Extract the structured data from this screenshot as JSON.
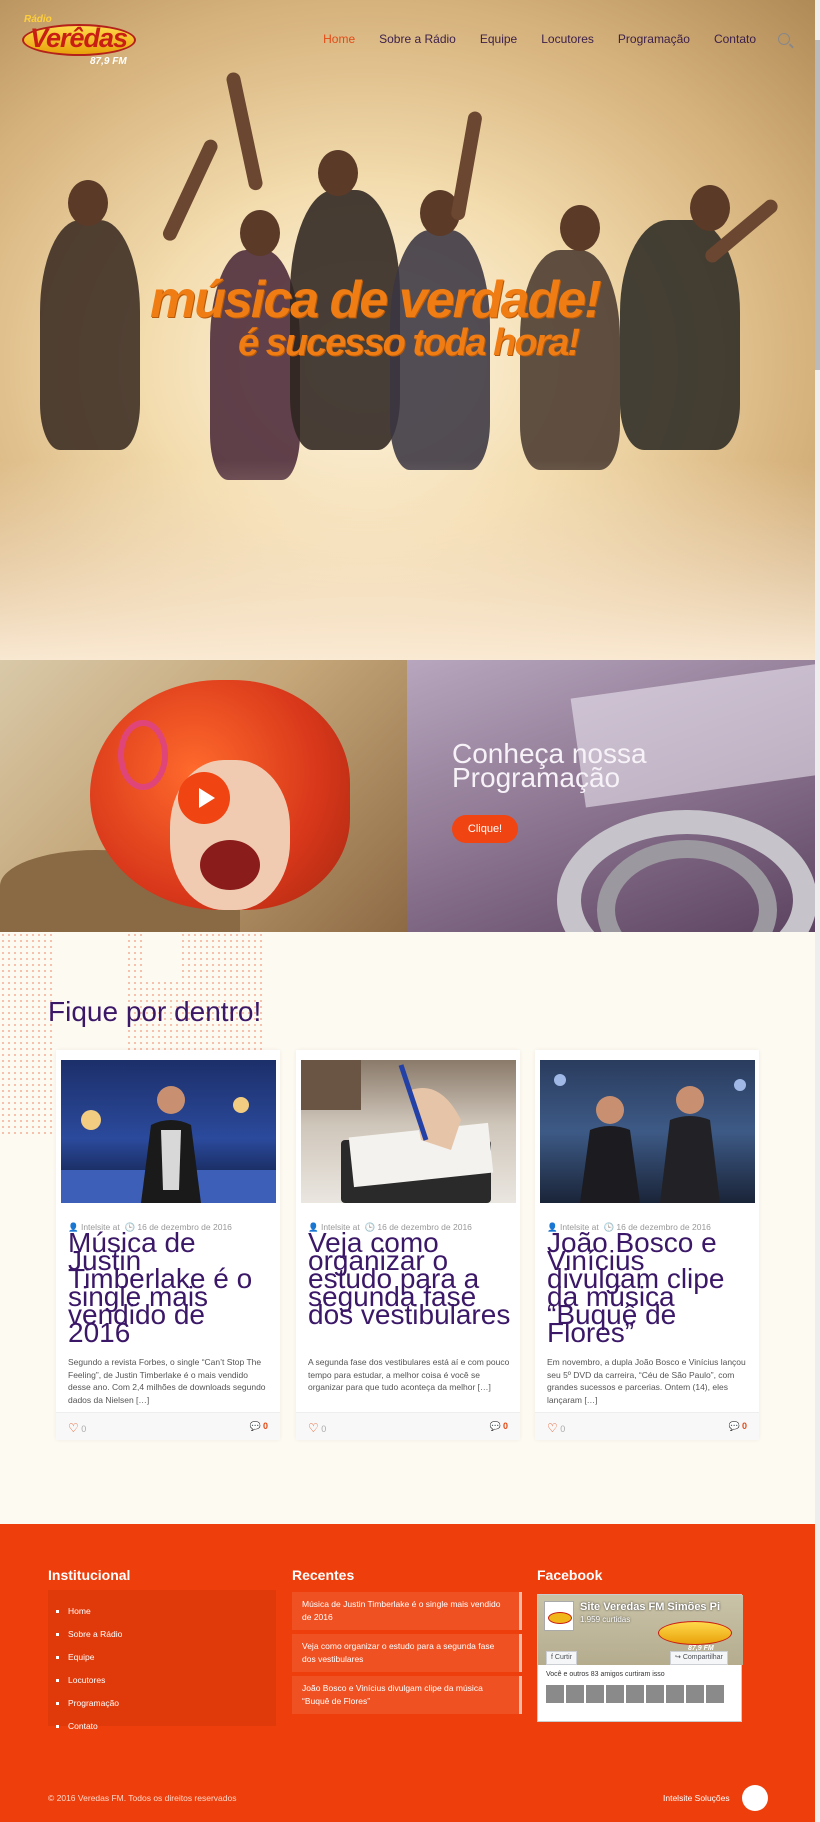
{
  "header": {
    "logo": {
      "top": "Rádio",
      "word": "Verêdas",
      "freq": "87,9 FM"
    },
    "nav": [
      {
        "label": "Home",
        "active": true
      },
      {
        "label": "Sobre a Rádio"
      },
      {
        "label": "Equipe"
      },
      {
        "label": "Locutores"
      },
      {
        "label": "Programação"
      },
      {
        "label": "Contato"
      }
    ],
    "search_icon": "search-icon"
  },
  "hero": {
    "line1": "música de verdade!",
    "line2": "é sucesso toda hora!"
  },
  "promo": {
    "heading": "Conheça nossa Programação",
    "button": "Clique!"
  },
  "news": {
    "title": "Fique por dentro!",
    "cards": [
      {
        "author": "Intelsite",
        "at": "at",
        "date": "16 de dezembro de 2016",
        "title": "Música de Justin Timberlake é o single mais vendido de 2016",
        "excerpt": "Segundo a revista Forbes, o single “Can’t Stop The Feeling”, de Justin Timberlake é o mais vendido desse ano. Com 2,4 milhões de downloads segundo dados da Nielsen […]",
        "likes": "0",
        "comments": "0"
      },
      {
        "author": "Intelsite",
        "at": "at",
        "date": "16 de dezembro de 2016",
        "title": "Veja como organizar o estudo para a segunda fase dos vestibulares",
        "excerpt": "A segunda fase dos vestibulares está aí e com pouco tempo para estudar, a melhor coisa é você se organizar para que tudo aconteça da melhor […]",
        "likes": "0",
        "comments": "0"
      },
      {
        "author": "Intelsite",
        "at": "at",
        "date": "16 de dezembro de 2016",
        "title": "João Bosco e Vinícius divulgam clipe da música “Buquê de Flores”",
        "excerpt": "Em novembro, a dupla João Bosco e Vinícius lançou seu 5º DVD da carreira, “Céu de São Paulo”, com grandes sucessos e parcerias. Ontem (14), eles lançaram […]",
        "likes": "0",
        "comments": "0"
      }
    ]
  },
  "footer": {
    "institucional": {
      "title": "Institucional",
      "items": [
        "Home",
        "Sobre a Rádio",
        "Equipe",
        "Locutores",
        "Programação",
        "Contato"
      ]
    },
    "recentes": {
      "title": "Recentes",
      "items": [
        "Música de Justin Timberlake é o single mais vendido de 2016",
        "Veja como organizar o estudo para a segunda fase dos vestibulares",
        "João Bosco e Vinícius divulgam clipe da música “Buquê de Flores”"
      ]
    },
    "facebook": {
      "title": "Facebook",
      "page_name": "Site Veredas FM Simões Pi",
      "likes": "1.959 curtidas",
      "like_button": "Curtir",
      "share_button": "Compartilhar",
      "friends_text": "Você e outros 83 amigos curtiram isso",
      "brand_word": "Verêdas",
      "brand_fm": "87,9 FM"
    },
    "copyright": "© 2016 Veredas FM. Todos os direitos reservados",
    "credit": "Intelsite Soluções"
  },
  "colors": {
    "accent": "#ee3e0b",
    "heading_purple": "#3b1767",
    "hero_text": "#f07c14"
  }
}
